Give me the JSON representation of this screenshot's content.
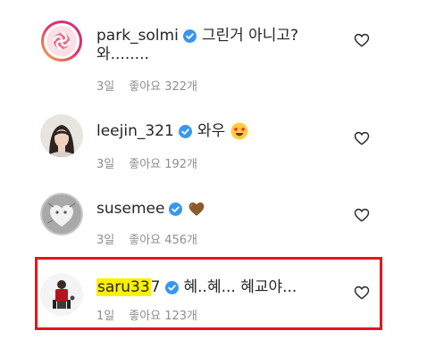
{
  "comments": [
    {
      "username": "park_solmi",
      "text": "그린거 아니고?",
      "text_line2": "와........",
      "time": "3일",
      "likes": "좋아요 322개"
    },
    {
      "username": "leejin_321",
      "text": "와우",
      "emoji": "star-struck-face-emoji",
      "time": "3일",
      "likes": "좋아요 192개"
    },
    {
      "username": "susemee",
      "text": "",
      "emoji": "brown-heart-emoji",
      "time": "3일",
      "likes": "좋아요 456개"
    },
    {
      "username_highlighted": "saru33",
      "username_rest": "7",
      "text": "혜..혜... 혜교야...",
      "time": "1일",
      "likes": "좋아요 123개"
    }
  ],
  "colors": {
    "verified": "#3897f0",
    "meta": "#8e8e8e",
    "highlight": "#fff000",
    "annotation_box": "#e8141b"
  }
}
